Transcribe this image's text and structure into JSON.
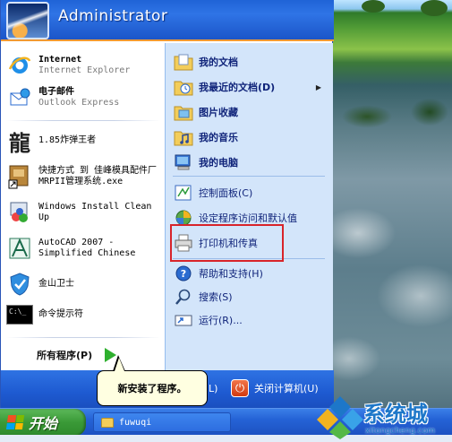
{
  "header": {
    "user_name": "Administrator"
  },
  "left_pane": {
    "pinned": [
      {
        "title": "Internet",
        "subtitle": "Internet Explorer",
        "icon": "internet-explorer-icon"
      },
      {
        "title": "电子邮件",
        "subtitle": "Outlook Express",
        "icon": "outlook-express-icon"
      }
    ],
    "recent": [
      {
        "label": "1.85炸弹王者",
        "icon": "dragon-glyph-icon",
        "glyph": "龍"
      },
      {
        "label": "快捷方式 到 佳峰模具配件厂MRPII管理系统.exe",
        "icon": "shortcut-app-icon"
      },
      {
        "label": "Windows Install Clean Up",
        "icon": "install-cleanup-icon"
      },
      {
        "label": "AutoCAD 2007 - Simplified Chinese",
        "icon": "autocad-icon"
      },
      {
        "label": "金山卫士",
        "icon": "shield-icon"
      },
      {
        "label": "命令提示符",
        "icon": "command-prompt-icon",
        "glyph": "C:\\_"
      }
    ],
    "all_programs": "所有程序(P)"
  },
  "right_pane": {
    "items": [
      {
        "label": "我的文档",
        "icon": "my-documents-icon",
        "bold": true
      },
      {
        "label": "我最近的文档(D)",
        "icon": "recent-documents-icon",
        "bold": true,
        "submenu": true
      },
      {
        "label": "图片收藏",
        "icon": "my-pictures-icon",
        "bold": true
      },
      {
        "label": "我的音乐",
        "icon": "my-music-icon",
        "bold": true
      },
      {
        "label": "我的电脑",
        "icon": "my-computer-icon",
        "bold": true
      },
      {
        "label": "控制面板(C)",
        "icon": "control-panel-icon",
        "bold": false
      },
      {
        "label": "设定程序访问和默认值",
        "icon": "program-access-icon",
        "bold": false
      },
      {
        "label": "打印机和传真",
        "icon": "printer-icon",
        "bold": false
      },
      {
        "label": "帮助和支持(H)",
        "icon": "help-icon",
        "bold": false
      },
      {
        "label": "搜索(S)",
        "icon": "search-icon",
        "bold": false
      },
      {
        "label": "运行(R)...",
        "icon": "run-icon",
        "bold": false
      }
    ],
    "submenu_arrow": "▶"
  },
  "bottom_bar": {
    "logoff_letter": "L)",
    "shutdown_label": "关闭计算机(U)",
    "power_glyph": "⏻"
  },
  "balloon": {
    "text": "新安装了程序。"
  },
  "taskbar": {
    "start_label": "开始",
    "task_label": "fuwuqi"
  },
  "watermark": {
    "title": "系统城",
    "url": "xitongcheng.com"
  },
  "colors": {
    "accent_blue": "#1f63d6",
    "highlight_red": "#d8232a",
    "start_green": "#3a9a37"
  }
}
